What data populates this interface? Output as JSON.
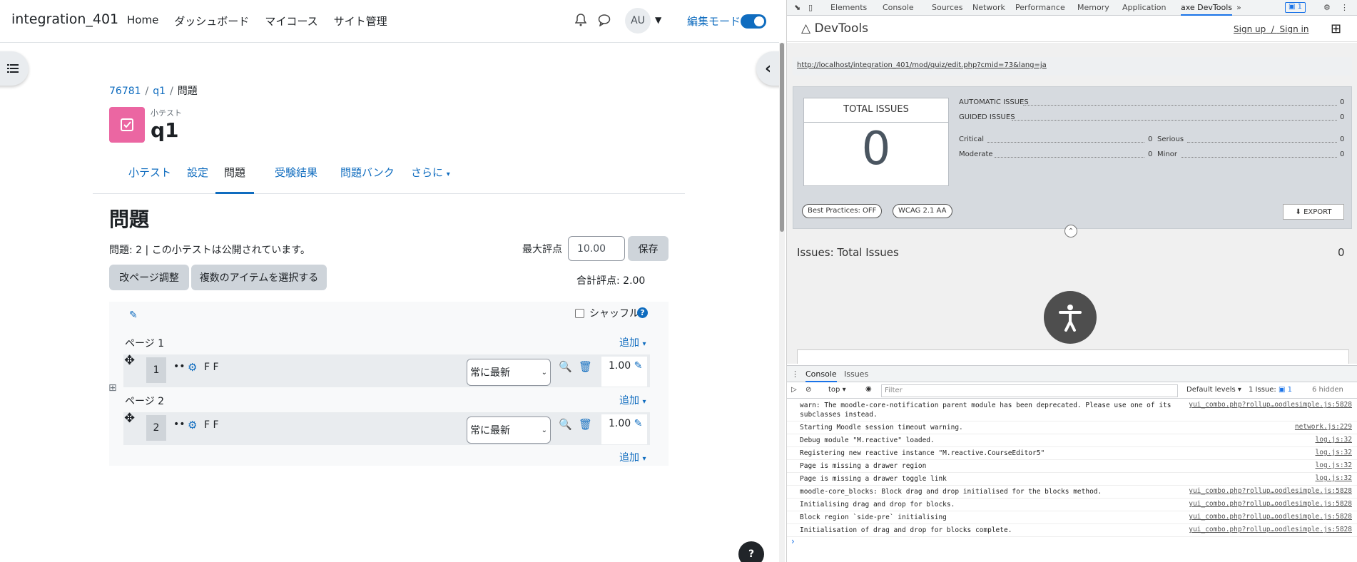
{
  "navbar": {
    "site_name": "integration_401",
    "nav_items": [
      "Home",
      "ダッシュボード",
      "マイコース",
      "サイト管理"
    ],
    "avatar": "AU",
    "edit_mode_label": "編集モード"
  },
  "breadcrumb": [
    "76781",
    "q1",
    "問題"
  ],
  "quiz": {
    "kind": "小テスト",
    "title": "q1"
  },
  "secondary_nav": [
    "小テスト",
    "設定",
    "問題",
    "受験結果",
    "問題バンク",
    "さらに"
  ],
  "main": {
    "heading": "問題",
    "info": "問題: 2 | この小テストは公開されています。",
    "max_grade_label": "最大評点",
    "max_grade_value": "10.00",
    "save_label": "保存",
    "repaginate_label": "改ページ調整",
    "select_multiple_label": "複数のアイテムを選択する",
    "total_label": "合計評点: 2.00",
    "shuffle_label": "シャッフル",
    "add_label": "追加",
    "pages": [
      {
        "label": "ページ 1",
        "slot": {
          "number": "1",
          "name": "F F",
          "version": "常に最新",
          "mark": "1.00"
        }
      },
      {
        "label": "ページ 2",
        "slot": {
          "number": "2",
          "name": "F F",
          "version": "常に最新",
          "mark": "1.00"
        }
      }
    ]
  },
  "devtools": {
    "tabs": [
      "Elements",
      "Console",
      "Sources",
      "Network",
      "Performance",
      "Memory",
      "Application",
      "axe DevTools"
    ],
    "issue_badge": "1",
    "axe": {
      "title": "DevTools",
      "signup": "Sign up",
      "signin": "Sign in",
      "test_url": "http://localhost/integration_401/mod/quiz/edit.php?cmid=73&lang=ja",
      "total_label": "TOTAL ISSUES",
      "total_value": "0",
      "automatic_label": "AUTOMATIC ISSUES",
      "automatic_value": "0",
      "guided_label": "GUIDED ISSUES",
      "guided_value": "0",
      "critical_label": "Critical",
      "critical_value": "0",
      "serious_label": "Serious",
      "serious_value": "0",
      "moderate_label": "Moderate",
      "moderate_value": "0",
      "minor_label": "Minor",
      "minor_value": "0",
      "best_practices": "Best Practices: OFF",
      "wcag": "WCAG 2.1 AA",
      "export": "EXPORT",
      "issues_heading": "Issues: Total Issues",
      "issues_count": "0"
    },
    "console_tabs": [
      "Console",
      "Issues"
    ],
    "context": "top",
    "filter_placeholder": "Filter",
    "levels": "Default levels",
    "issues_count_label": "1 Issue: ",
    "issues_count_num": "1",
    "hidden_label": "6 hidden",
    "lines": [
      {
        "msg": "warn: The moodle-core-notification parent module has been deprecated. Please use one of its subclasses instead.",
        "src": "yui_combo.php?rollup…oodlesimple.js:5828"
      },
      {
        "msg": "Starting Moodle session timeout warning.",
        "src": "network.js:229"
      },
      {
        "msg": "Debug module \"M.reactive\" loaded.",
        "src": "log.js:32"
      },
      {
        "msg": "Registering new reactive instance \"M.reactive.CourseEditor5\"",
        "src": "log.js:32"
      },
      {
        "msg": "Page is missing a drawer region",
        "src": "log.js:32"
      },
      {
        "msg": "Page is missing a drawer toggle link",
        "src": "log.js:32"
      },
      {
        "msg": "moodle-core_blocks: Block drag and drop initialised for the blocks method.",
        "src": "yui_combo.php?rollup…oodlesimple.js:5828"
      },
      {
        "msg": "Initialising drag and drop for blocks.",
        "src": "yui_combo.php?rollup…oodlesimple.js:5828"
      },
      {
        "msg": "Block region `side-pre` initialising",
        "src": "yui_combo.php?rollup…oodlesimple.js:5828"
      },
      {
        "msg": "Initialisation of drag and drop for blocks complete.",
        "src": "yui_combo.php?rollup…oodlesimple.js:5828"
      }
    ]
  }
}
